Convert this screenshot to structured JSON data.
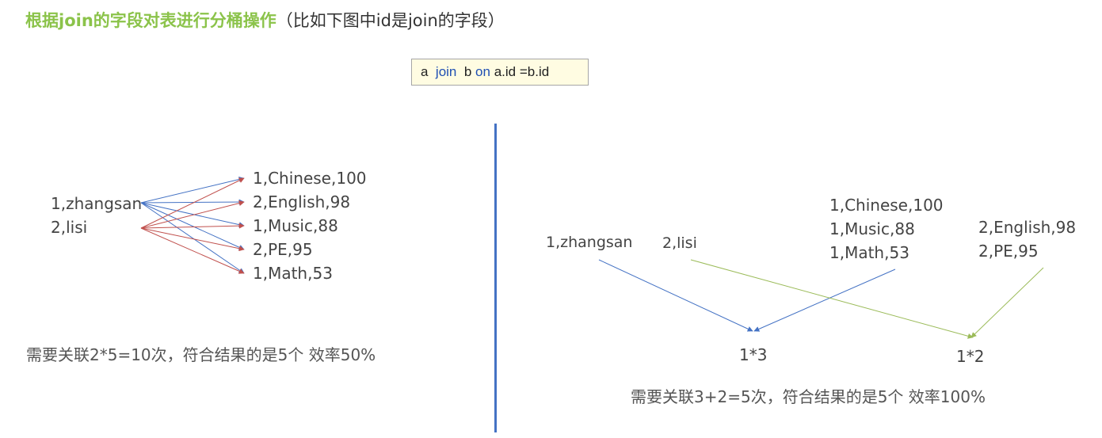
{
  "title": {
    "main": "根据join的字段对表进行分桶操作",
    "note": "（比如下图中id是join的字段）"
  },
  "sql": {
    "t1": "a",
    "join": "join",
    "t2": "b",
    "on": "on",
    "cond": "a.id =b.id"
  },
  "left": {
    "sources": [
      "1,zhangsan",
      "2,lisi"
    ],
    "targets": [
      "1,Chinese,100",
      "2,English,98",
      "1,Music,88",
      "2,PE,95",
      "1,Math,53"
    ],
    "summary": "需要关联2*5=10次，符合结果的是5个 效率50%"
  },
  "right": {
    "source_1": "1,zhangsan",
    "source_2": "2,lisi",
    "group_1": [
      "1,Chinese,100",
      "1,Music,88",
      "1,Math,53"
    ],
    "group_2": [
      "2,English,98",
      "2,PE,95"
    ],
    "result_1": "1*3",
    "result_2": "1*2",
    "summary": "需要关联3+2=5次，符合结果的是5个 效率100%"
  },
  "colors": {
    "title_green": "#8BC34A",
    "blue_arrow": "#4472C4",
    "red_arrow": "#C0504D",
    "green_arrow": "#9BBB59",
    "divider": "#4472C4",
    "sql_keyword": "#1F4FB3",
    "sql_box_bg": "#FFFCE2"
  }
}
